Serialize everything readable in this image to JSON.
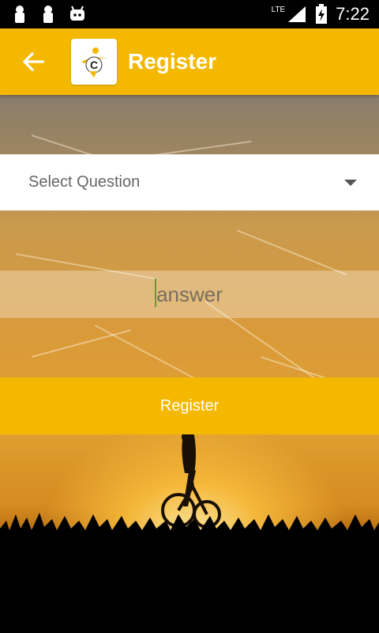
{
  "status_bar": {
    "time": "7:22",
    "network": "LTE",
    "left_icons": [
      "notification-icon",
      "notification-icon",
      "android-icon"
    ],
    "right_icons": [
      "signal-icon",
      "battery-charging-icon"
    ]
  },
  "app_bar": {
    "title": "Register",
    "back_icon": "arrow-back-icon",
    "logo_letter": "C",
    "color": "#f5b800"
  },
  "form": {
    "select_question": "Select Question",
    "answer_placeholder": "answer",
    "register_label": "Register"
  },
  "colors": {
    "accent": "#f5b800",
    "text_on_accent": "#ffffff"
  }
}
